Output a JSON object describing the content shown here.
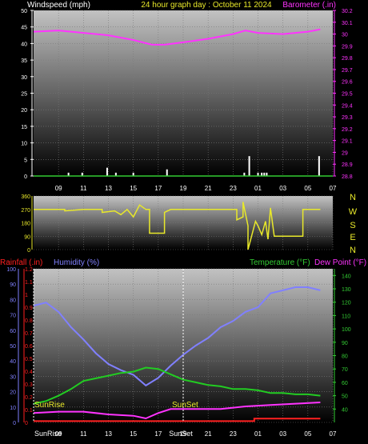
{
  "header": {
    "left_title": "Windspeed (mph)",
    "center_title": "24 hour graph day : October 11 2024",
    "right_title": "Barometer (.in)"
  },
  "direction_labels": [
    "N",
    "W",
    "S",
    "E",
    "N"
  ],
  "bottom_header": {
    "rainfall": "Rainfall (.in)",
    "humidity": "Humidity (%)",
    "temperature": "Temperature (°F)",
    "dewpoint": "Dew Point (°F)"
  },
  "events": {
    "sunrise_label": "SunRise",
    "sunset_label": "SunSet",
    "sunset_axis_label": "SunSet"
  },
  "bottom_x_first": "SunRise",
  "colors": {
    "wind": "#ffffff",
    "barometer": "#ff33ff",
    "direction": "#e8e82a",
    "rainfall": "#ff2020",
    "humidity": "#8080ff",
    "temperature": "#22cc22",
    "dewpoint": "#ff33ff",
    "axis_yellow": "#e8e82a",
    "axis_green": "#33cc33"
  },
  "chart_data": [
    {
      "type": "bar+line",
      "title": "24 hour graph day : October 11 2024",
      "x_ticks": [
        "09",
        "11",
        "13",
        "15",
        "17",
        "19",
        "21",
        "23",
        "01",
        "03",
        "05",
        "07"
      ],
      "left_axis": {
        "label": "Windspeed (mph)",
        "range": [
          0,
          50
        ],
        "ticks": [
          0,
          5,
          10,
          15,
          20,
          25,
          30,
          35,
          40,
          45,
          50
        ]
      },
      "right_axis": {
        "label": "Barometer (.in)",
        "range": [
          28.8,
          30.2
        ],
        "ticks": [
          "28.8",
          "28.9",
          "29",
          "29.1",
          "29.2",
          "29.3",
          "29.4",
          "29.5",
          "29.6",
          "29.7",
          "29.8",
          "29.9",
          "30",
          "30.1",
          "30.2"
        ]
      },
      "series": [
        {
          "name": "Windspeed (mph)",
          "bars": [
            [
              9.8,
              1
            ],
            [
              10.9,
              1
            ],
            [
              12.9,
              2.5
            ],
            [
              13.6,
              1
            ],
            [
              15.0,
              1
            ],
            [
              17.7,
              2
            ],
            [
              23.9,
              1
            ],
            [
              24.3,
              6
            ],
            [
              25.0,
              1
            ],
            [
              25.3,
              1
            ],
            [
              25.5,
              1
            ],
            [
              25.7,
              1
            ],
            [
              29.9,
              6
            ]
          ]
        },
        {
          "name": "Barometer (.in)",
          "points": [
            [
              7,
              30.02
            ],
            [
              9,
              30.03
            ],
            [
              11,
              30.01
            ],
            [
              13,
              29.99
            ],
            [
              15,
              29.95
            ],
            [
              16.5,
              29.91
            ],
            [
              17.5,
              29.91
            ],
            [
              19,
              29.93
            ],
            [
              21,
              29.96
            ],
            [
              23,
              30.0
            ],
            [
              24,
              30.03
            ],
            [
              25,
              30.01
            ],
            [
              27,
              30.0
            ],
            [
              29,
              30.02
            ],
            [
              30,
              30.04
            ]
          ]
        }
      ],
      "grid": true
    },
    {
      "type": "line",
      "x_ticks": [
        "09",
        "11",
        "13",
        "15",
        "17",
        "19",
        "21",
        "23",
        "01",
        "03",
        "05",
        "07"
      ],
      "left_axis": {
        "range": [
          0,
          360
        ],
        "ticks": [
          0,
          90,
          180,
          270,
          360
        ]
      },
      "right_axis": {
        "labels": [
          "N",
          "W",
          "S",
          "E",
          "N"
        ]
      },
      "series": [
        {
          "name": "Wind Direction",
          "points": [
            [
              7,
              270
            ],
            [
              9.5,
              270
            ],
            [
              9.5,
              260
            ],
            [
              11,
              270
            ],
            [
              12.5,
              270
            ],
            [
              12.5,
              250
            ],
            [
              13.5,
              260
            ],
            [
              14,
              235
            ],
            [
              14.5,
              270
            ],
            [
              15,
              220
            ],
            [
              15.5,
              300
            ],
            [
              16,
              270
            ],
            [
              16.3,
              270
            ],
            [
              16.3,
              110
            ],
            [
              17.5,
              110
            ],
            [
              17.5,
              250
            ],
            [
              18,
              270
            ],
            [
              23.3,
              270
            ],
            [
              23.3,
              200
            ],
            [
              23.8,
              220
            ],
            [
              23.8,
              320
            ],
            [
              24.2,
              160
            ],
            [
              24.2,
              0
            ],
            [
              24.8,
              190
            ],
            [
              25.0,
              160
            ],
            [
              25.3,
              100
            ],
            [
              25.6,
              190
            ],
            [
              25.8,
              70
            ],
            [
              26.0,
              280
            ],
            [
              26.3,
              90
            ],
            [
              28.6,
              90
            ],
            [
              28.6,
              270
            ],
            [
              30,
              270
            ]
          ]
        }
      ],
      "grid": true
    },
    {
      "type": "line",
      "x_ticks": [
        "SunRise",
        "09",
        "11",
        "13",
        "15",
        "17",
        "SunSet",
        "19",
        "21",
        "23",
        "01",
        "03",
        "05",
        "07"
      ],
      "rainfall_axis": {
        "label": "Rainfall (.in)",
        "range": [
          0,
          1.2
        ],
        "ticks": [
          "0",
          "0.1",
          "0.2",
          "0.3",
          "0.4",
          "0.5",
          "0.6",
          "0.7",
          "0.8",
          "0.9",
          "1",
          "1.1",
          "1.2"
        ]
      },
      "humidity_axis": {
        "label": "Humidity (%)",
        "range": [
          0,
          100
        ],
        "ticks": [
          0,
          10,
          20,
          30,
          40,
          50,
          60,
          70,
          80,
          90,
          100
        ]
      },
      "temperature_axis": {
        "label": "Temperature (°F)",
        "range": [
          30,
          145
        ],
        "ticks": [
          40,
          50,
          60,
          70,
          80,
          90,
          100,
          110,
          120,
          130,
          140
        ]
      },
      "series": [
        {
          "name": "Rainfall (.in)",
          "axis": "rain",
          "points": [
            [
              7,
              0.01
            ],
            [
              24.7,
              0.01
            ],
            [
              24.7,
              0.03
            ],
            [
              30,
              0.03
            ]
          ]
        },
        {
          "name": "Humidity (%)",
          "axis": "humidity",
          "points": [
            [
              7,
              76
            ],
            [
              8,
              78
            ],
            [
              9,
              72
            ],
            [
              10,
              62
            ],
            [
              11,
              54
            ],
            [
              12,
              45
            ],
            [
              13,
              38
            ],
            [
              14,
              34
            ],
            [
              15,
              31
            ],
            [
              16,
              24
            ],
            [
              17,
              29
            ],
            [
              18,
              37
            ],
            [
              19,
              44
            ],
            [
              20,
              50
            ],
            [
              21,
              55
            ],
            [
              22,
              62
            ],
            [
              23,
              66
            ],
            [
              24,
              72
            ],
            [
              25,
              75
            ],
            [
              26,
              84
            ],
            [
              27,
              86
            ],
            [
              28,
              88
            ],
            [
              29,
              88
            ],
            [
              30,
              86
            ]
          ]
        },
        {
          "name": "Temperature (°F)",
          "axis": "temp",
          "points": [
            [
              7,
              44
            ],
            [
              8,
              46
            ],
            [
              9,
              50
            ],
            [
              10,
              55
            ],
            [
              11,
              61
            ],
            [
              12,
              63
            ],
            [
              13,
              65
            ],
            [
              14,
              67
            ],
            [
              15,
              68
            ],
            [
              16,
              71
            ],
            [
              17,
              70
            ],
            [
              18,
              66
            ],
            [
              19,
              62
            ],
            [
              20,
              60
            ],
            [
              21,
              58
            ],
            [
              22,
              57
            ],
            [
              23,
              55
            ],
            [
              24,
              55
            ],
            [
              25,
              54
            ],
            [
              26,
              52
            ],
            [
              27,
              52
            ],
            [
              28,
              51
            ],
            [
              29,
              51
            ],
            [
              30,
              50
            ]
          ]
        },
        {
          "name": "Dew Point (°F)",
          "axis": "temp",
          "points": [
            [
              7,
              37
            ],
            [
              9,
              38
            ],
            [
              11,
              38
            ],
            [
              13,
              36
            ],
            [
              15,
              35
            ],
            [
              16,
              33
            ],
            [
              17,
              37
            ],
            [
              18,
              40
            ],
            [
              20,
              40
            ],
            [
              22,
              40
            ],
            [
              24,
              42
            ],
            [
              26,
              43
            ],
            [
              28,
              44
            ],
            [
              30,
              45
            ]
          ]
        }
      ],
      "grid": true
    }
  ]
}
